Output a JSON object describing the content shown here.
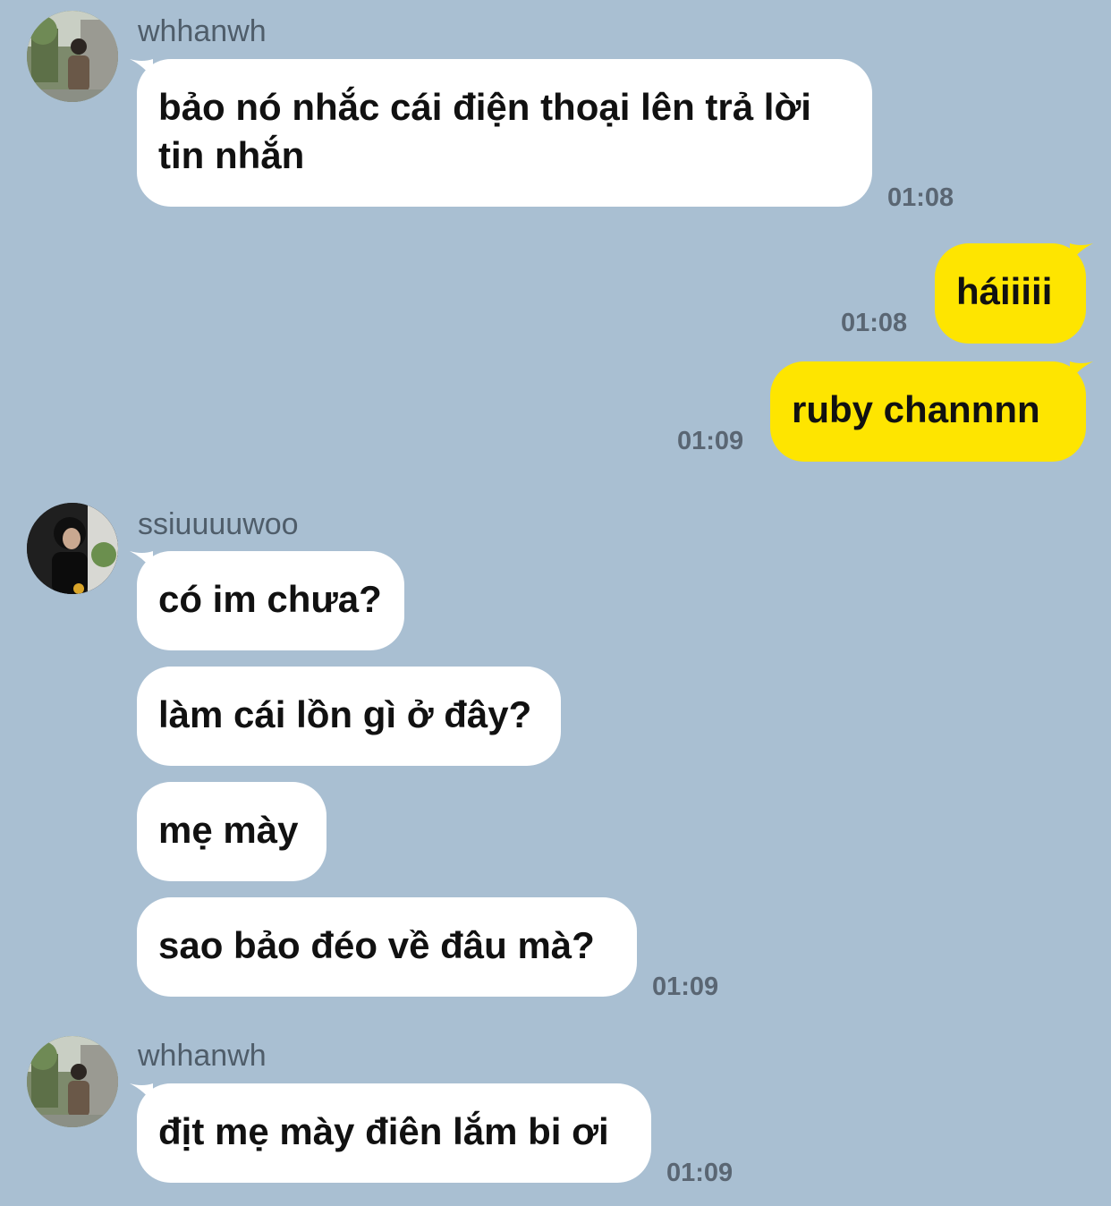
{
  "colors": {
    "background": "#a9bfd2",
    "incoming_bubble": "#ffffff",
    "outgoing_bubble": "#fee500",
    "timestamp": "#5a6673",
    "sender_name": "#4f5d6a"
  },
  "messages": [
    {
      "sender": "whhanwh",
      "avatar_icon": "avatar-photo-icon",
      "text": "bảo nó nhắc cái điện thoại lên trả lời tin nhắn",
      "time": "01:08"
    },
    {
      "direction": "outgoing",
      "text": "háiiiii",
      "time": "01:08"
    },
    {
      "direction": "outgoing",
      "text": "ruby channnn",
      "time": "01:09"
    },
    {
      "sender": "ssiuuuuwoo",
      "avatar_icon": "avatar-photo-icon",
      "text": "có im chưa?"
    },
    {
      "text": "làm cái lồn gì ở đây?"
    },
    {
      "text": "mẹ mày"
    },
    {
      "text": "sao bảo đéo về đâu mà?",
      "time": "01:09"
    },
    {
      "sender": "whhanwh",
      "avatar_icon": "avatar-photo-icon",
      "text": "địt mẹ mày điên lắm bi ơi",
      "time": "01:09"
    }
  ]
}
